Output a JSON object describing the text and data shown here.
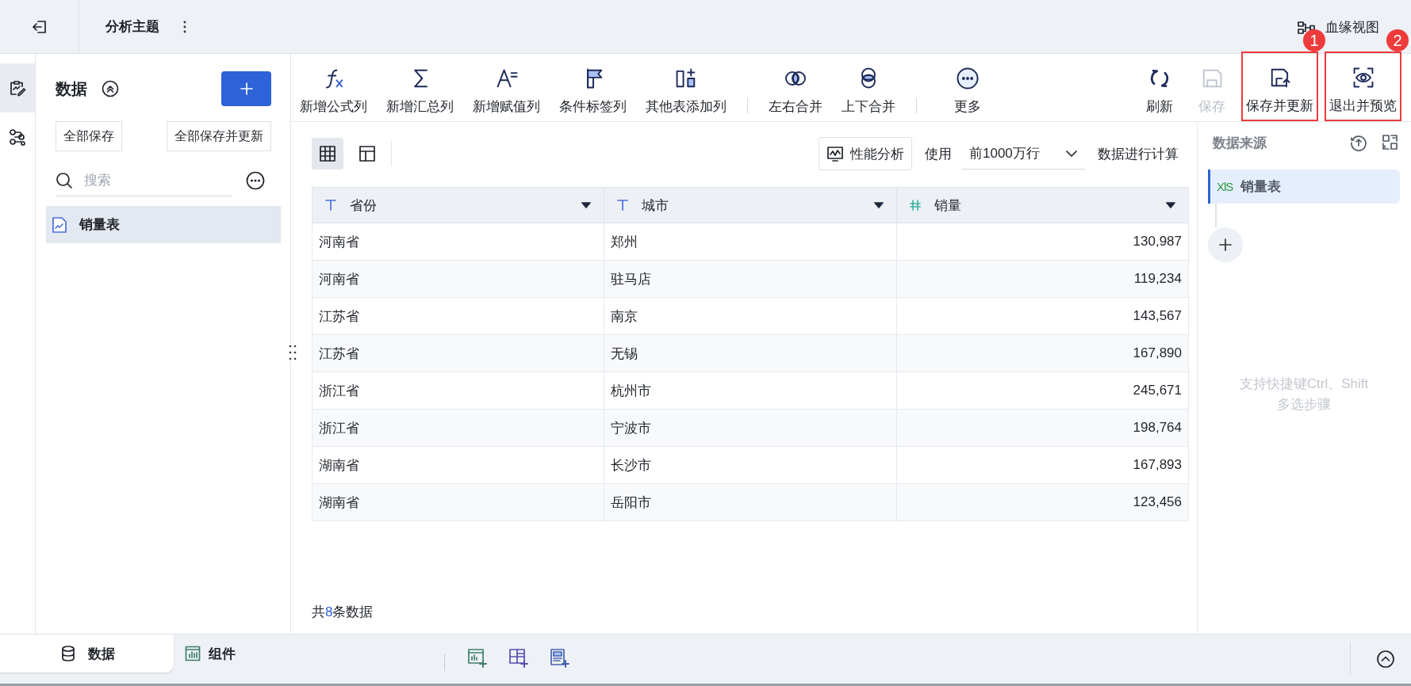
{
  "top_bar": {
    "title": "分析主题",
    "lineage_link": "血缘视图"
  },
  "rail": [
    {
      "kind": "data",
      "selected": true
    },
    {
      "kind": "flow",
      "selected": false
    }
  ],
  "data_panel": {
    "title": "数据",
    "expanded": true,
    "actions": [
      "全部保存",
      "全部保存并更新"
    ],
    "search": {
      "placeholder": "搜索"
    },
    "tables": [
      {
        "name": "销量表",
        "selected": true
      }
    ]
  },
  "toolbar": {
    "groups": [
      [
        {
          "kind": "formula",
          "label": "新增公式列"
        },
        {
          "kind": "sum",
          "label": "新增汇总列"
        },
        {
          "kind": "assign",
          "label": "新增赋值列"
        },
        {
          "kind": "condition",
          "label": "条件标签列"
        },
        {
          "kind": "other",
          "label": "其他表添加列"
        }
      ],
      [
        {
          "kind": "merge_h",
          "label": "左右合并"
        },
        {
          "kind": "merge_v",
          "label": "上下合并"
        }
      ],
      [
        {
          "kind": "more",
          "label": "更多"
        }
      ]
    ],
    "actions": [
      {
        "kind": "refresh",
        "label": "刷新",
        "disabled": false
      },
      {
        "kind": "save",
        "label": "保存",
        "disabled": true
      },
      {
        "kind": "save_update",
        "label": "保存并更新",
        "disabled": false,
        "callout": "1"
      },
      {
        "kind": "exit_preview",
        "label": "退出并预览",
        "disabled": false,
        "callout": "2"
      }
    ]
  },
  "grid_toolbar": {
    "views": [
      {
        "kind": "grid",
        "selected": true
      },
      {
        "kind": "layout",
        "selected": false
      }
    ],
    "perf_button": "性能分析",
    "limit_label": "使用",
    "limit_select": "前1000万行",
    "limit_suffix": "数据进行计算"
  },
  "table": {
    "columns": [
      {
        "name": "省份",
        "kind": "text"
      },
      {
        "name": "城市",
        "kind": "text"
      },
      {
        "name": "销量",
        "kind": "number"
      }
    ],
    "rows": [
      [
        "河南省",
        "郑州",
        "130,987"
      ],
      [
        "河南省",
        "驻马店",
        "119,234"
      ],
      [
        "江苏省",
        "南京",
        "143,567"
      ],
      [
        "江苏省",
        "无锡",
        "167,890"
      ],
      [
        "浙江省",
        "杭州市",
        "245,671"
      ],
      [
        "浙江省",
        "宁波市",
        "198,764"
      ],
      [
        "湖南省",
        "长沙市",
        "167,893"
      ],
      [
        "湖南省",
        "岳阳市",
        "123,456"
      ]
    ]
  },
  "footer": {
    "prefix": "共",
    "count": "8",
    "suffix": "条数据"
  },
  "source_panel": {
    "title": "数据来源",
    "sources": [
      {
        "file_type": "XlS",
        "name": "销量表",
        "selected": true
      }
    ],
    "hint_lines": [
      "支持快捷键Ctrl、Shift",
      "多选步骤"
    ]
  },
  "bottom_bar": {
    "tabs": [
      {
        "kind": "data",
        "label": "数据",
        "selected": true
      },
      {
        "kind": "component",
        "label": "组件",
        "selected": false
      }
    ]
  }
}
